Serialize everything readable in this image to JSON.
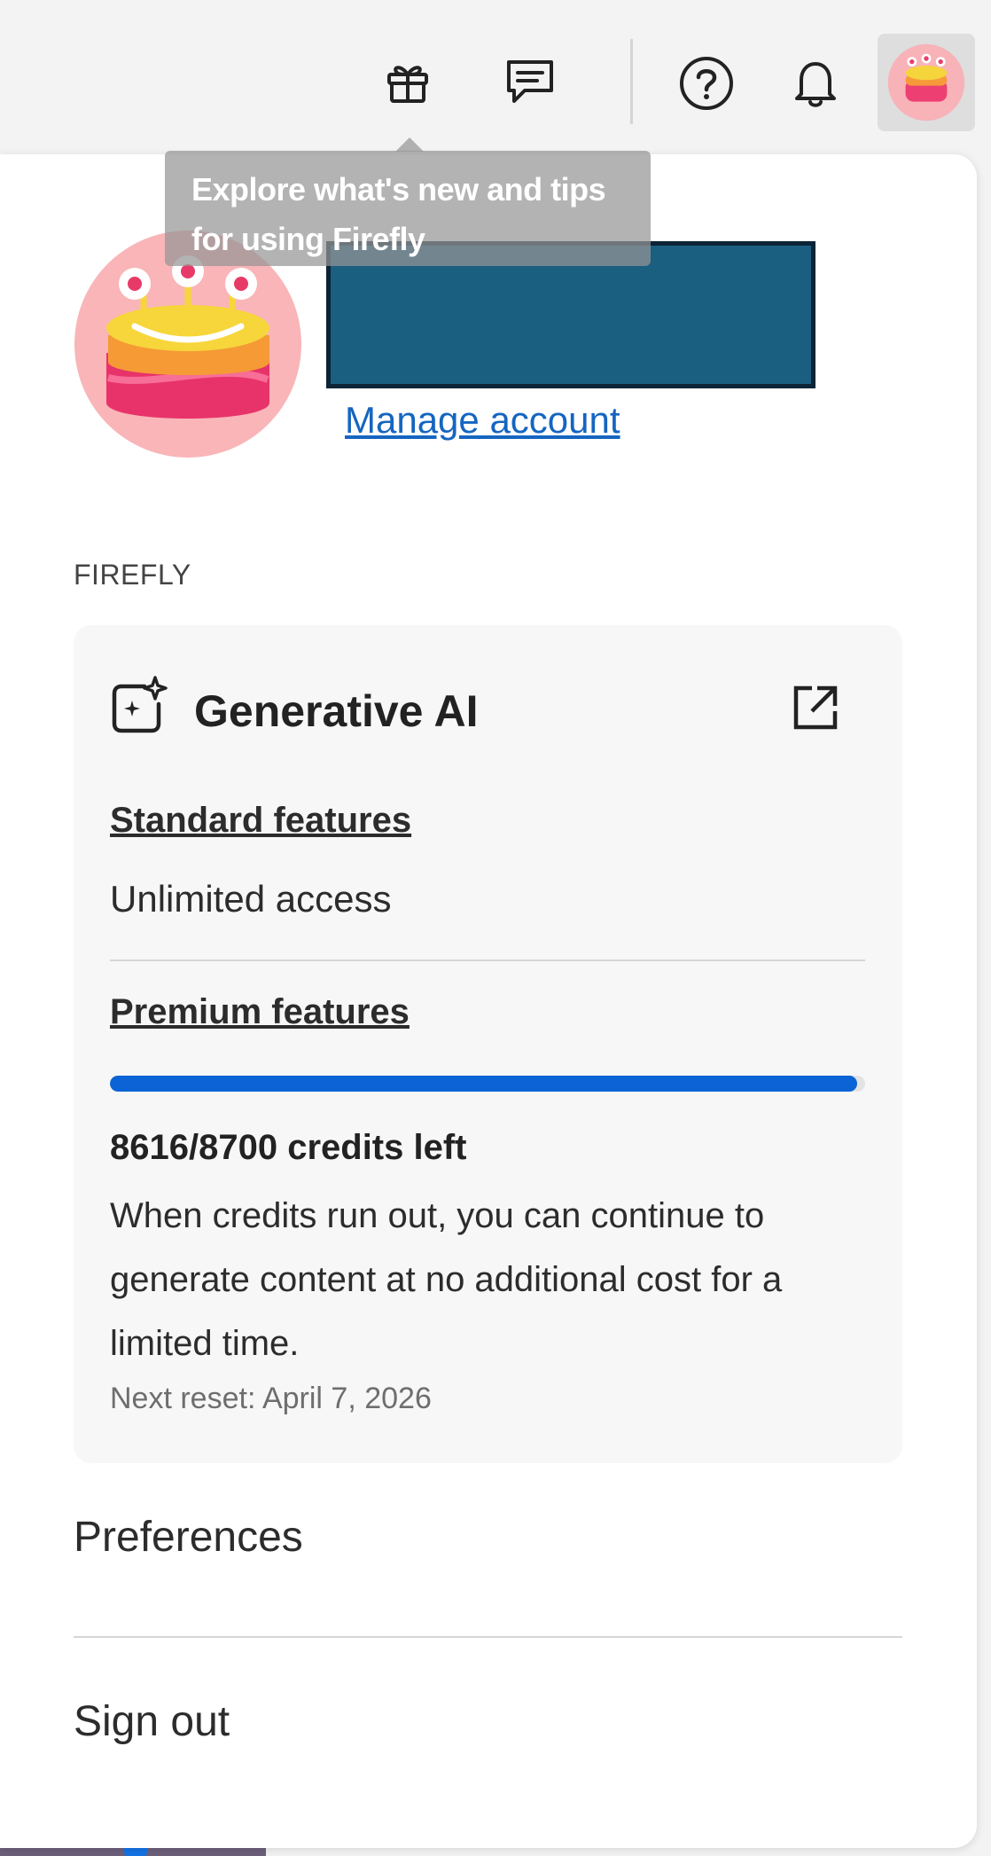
{
  "header": {
    "icons": [
      "gift-icon",
      "chat-icon",
      "help-icon",
      "bell-icon",
      "avatar"
    ]
  },
  "tooltip": {
    "text": "Explore what's new and tips for using Firefly"
  },
  "account": {
    "manage_link": "Manage account"
  },
  "section": {
    "label": "FIREFLY"
  },
  "card": {
    "title": "Generative AI",
    "standard_label": "Standard features",
    "standard_value": "Unlimited access",
    "premium_label": "Premium features",
    "credits_used_fraction": 0.99,
    "credits_text": "8616/8700 credits left",
    "credits_desc": "When credits run out, you can continue to generate content at no additional cost for a limited time.",
    "next_reset": "Next reset: April 7, 2026"
  },
  "menu": {
    "preferences": "Preferences",
    "sign_out": "Sign out"
  },
  "colors": {
    "accent": "#0b63d6",
    "link": "#1565c0",
    "redaction": "#1a5e80"
  }
}
